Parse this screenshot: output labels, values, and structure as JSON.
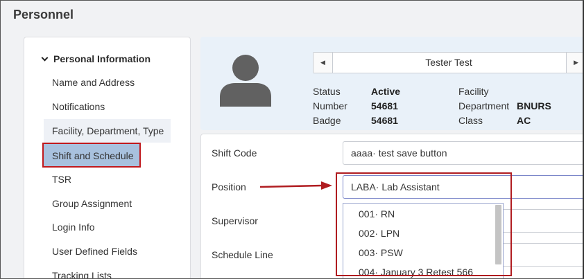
{
  "page": {
    "title": "Personnel"
  },
  "sidebar": {
    "section_title": "Personal Information",
    "items": [
      {
        "label": "Name and Address"
      },
      {
        "label": "Notifications"
      },
      {
        "label": "Facility, Department, Type"
      },
      {
        "label": "Shift and Schedule"
      },
      {
        "label": "TSR"
      },
      {
        "label": "Group Assignment"
      },
      {
        "label": "Login Info"
      },
      {
        "label": "User Defined Fields"
      },
      {
        "label": "Tracking Lists"
      }
    ],
    "selected_item": "Shift and Schedule"
  },
  "profile": {
    "employee_name": "Tester Test",
    "prev_icon": "caret-left-icon",
    "next_icon": "caret-right-icon",
    "fields": {
      "status_label": "Status",
      "status_value": "Active",
      "number_label": "Number",
      "number_value": "54681",
      "badge_label": "Badge",
      "badge_value": "54681",
      "facility_label": "Facility",
      "facility_value": "",
      "department_label": "Department",
      "department_value": "BNURS",
      "class_label": "Class",
      "class_value": "AC"
    }
  },
  "form": {
    "shift_code_label": "Shift Code",
    "shift_code_value": "aaaa· test save button",
    "position_label": "Position",
    "position_value": "LABA· Lab Assistant",
    "supervisor_label": "Supervisor",
    "schedule_line_label": "Schedule Line",
    "position_options": [
      {
        "label": "001· RN"
      },
      {
        "label": "002· LPN"
      },
      {
        "label": "003· PSW"
      },
      {
        "label": "004· January 3 Retest 566"
      }
    ]
  },
  "colors": {
    "highlight_border": "#c0181c",
    "selected_bg": "#a8c1de",
    "profile_bg": "#e9f1f9"
  }
}
